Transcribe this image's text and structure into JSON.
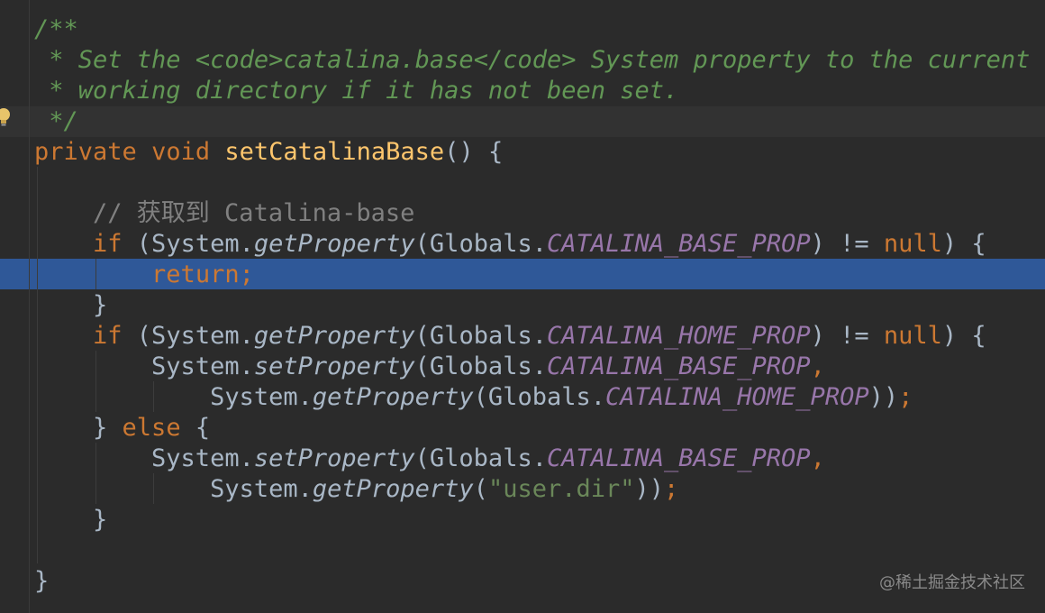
{
  "editor": {
    "lines": [
      {
        "tokens": [
          {
            "t": "/**",
            "c": "doc"
          }
        ]
      },
      {
        "tokens": [
          {
            "t": " * Set the ",
            "c": "doc"
          },
          {
            "t": "<code>",
            "c": "doc"
          },
          {
            "t": "catalina.base",
            "c": "doc"
          },
          {
            "t": "</code>",
            "c": "doc"
          },
          {
            "t": " System property to the current",
            "c": "doc"
          }
        ]
      },
      {
        "tokens": [
          {
            "t": " * working directory if it has not been set.",
            "c": "doc"
          }
        ]
      },
      {
        "tokens": [
          {
            "t": " */",
            "c": "doc"
          }
        ]
      },
      {
        "tokens": [
          {
            "t": "private",
            "c": "kw"
          },
          {
            "t": " ",
            "c": "txt"
          },
          {
            "t": "void",
            "c": "kw"
          },
          {
            "t": " ",
            "c": "txt"
          },
          {
            "t": "setCatalinaBase",
            "c": "fn"
          },
          {
            "t": "() {",
            "c": "txt"
          }
        ]
      },
      {
        "tokens": []
      },
      {
        "tokens": [
          {
            "t": "    ",
            "c": "txt"
          },
          {
            "t": "// 获取到 Catalina-base",
            "c": "cmt"
          }
        ]
      },
      {
        "tokens": [
          {
            "t": "    ",
            "c": "txt"
          },
          {
            "t": "if",
            "c": "kw"
          },
          {
            "t": " (System.",
            "c": "txt"
          },
          {
            "t": "getProperty",
            "c": "mth"
          },
          {
            "t": "(Globals.",
            "c": "txt"
          },
          {
            "t": "CATALINA_BASE_PROP",
            "c": "cst"
          },
          {
            "t": ") != ",
            "c": "txt"
          },
          {
            "t": "null",
            "c": "kw"
          },
          {
            "t": ") {",
            "c": "txt"
          }
        ]
      },
      {
        "tokens": [
          {
            "t": "        ",
            "c": "txt"
          },
          {
            "t": "return;",
            "c": "kw"
          }
        ]
      },
      {
        "tokens": [
          {
            "t": "    }",
            "c": "txt"
          }
        ]
      },
      {
        "tokens": [
          {
            "t": "    ",
            "c": "txt"
          },
          {
            "t": "if",
            "c": "kw"
          },
          {
            "t": " (System.",
            "c": "txt"
          },
          {
            "t": "getProperty",
            "c": "mth"
          },
          {
            "t": "(Globals.",
            "c": "txt"
          },
          {
            "t": "CATALINA_HOME_PROP",
            "c": "cst"
          },
          {
            "t": ") != ",
            "c": "txt"
          },
          {
            "t": "null",
            "c": "kw"
          },
          {
            "t": ") {",
            "c": "txt"
          }
        ]
      },
      {
        "tokens": [
          {
            "t": "        System.",
            "c": "txt"
          },
          {
            "t": "setProperty",
            "c": "mth"
          },
          {
            "t": "(Globals.",
            "c": "txt"
          },
          {
            "t": "CATALINA_BASE_PROP",
            "c": "cst"
          },
          {
            "t": ",",
            "c": "kw"
          }
        ]
      },
      {
        "tokens": [
          {
            "t": "            System.",
            "c": "txt"
          },
          {
            "t": "getProperty",
            "c": "mth"
          },
          {
            "t": "(Globals.",
            "c": "txt"
          },
          {
            "t": "CATALINA_HOME_PROP",
            "c": "cst"
          },
          {
            "t": "))",
            "c": "txt"
          },
          {
            "t": ";",
            "c": "kw"
          }
        ]
      },
      {
        "tokens": [
          {
            "t": "    } ",
            "c": "txt"
          },
          {
            "t": "else",
            "c": "kw"
          },
          {
            "t": " {",
            "c": "txt"
          }
        ]
      },
      {
        "tokens": [
          {
            "t": "        System.",
            "c": "txt"
          },
          {
            "t": "setProperty",
            "c": "mth"
          },
          {
            "t": "(Globals.",
            "c": "txt"
          },
          {
            "t": "CATALINA_BASE_PROP",
            "c": "cst"
          },
          {
            "t": ",",
            "c": "kw"
          }
        ]
      },
      {
        "tokens": [
          {
            "t": "            System.",
            "c": "txt"
          },
          {
            "t": "getProperty",
            "c": "mth"
          },
          {
            "t": "(",
            "c": "txt"
          },
          {
            "t": "\"user.dir\"",
            "c": "str"
          },
          {
            "t": "))",
            "c": "txt"
          },
          {
            "t": ";",
            "c": "kw"
          }
        ]
      },
      {
        "tokens": [
          {
            "t": "    }",
            "c": "txt"
          }
        ]
      },
      {
        "tokens": []
      },
      {
        "tokens": [
          {
            "t": "}",
            "c": "txt"
          }
        ]
      }
    ]
  },
  "watermark": "@稀土掘金技术社区",
  "icons": {
    "gutter": "lightbulb-icon"
  },
  "colors": {
    "background": "#2b2b2b",
    "selection": "#2f5898",
    "doc_comment": "#629755",
    "keyword": "#cc7832",
    "function_declaration": "#ffc66d",
    "constant": "#9876aa",
    "string": "#6a8759",
    "line_comment": "#808080",
    "plain_text": "#a9b7c6"
  }
}
